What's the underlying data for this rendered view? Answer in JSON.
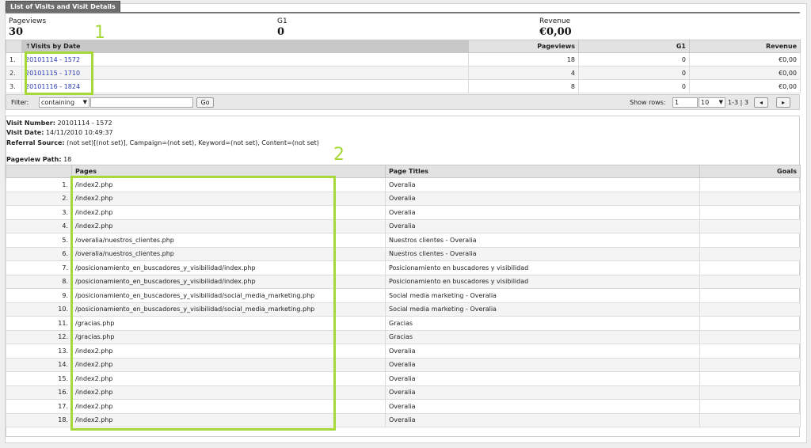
{
  "tab_title": "List of Visits and Visit Details",
  "summary": [
    {
      "label": "Pageviews",
      "value": "30"
    },
    {
      "label": "G1",
      "value": "0"
    },
    {
      "label": "Revenue",
      "value": "€0,00"
    }
  ],
  "visits": {
    "headers": {
      "sort_icon": "↑",
      "visit": "Visits by Date",
      "pageviews": "Pageviews",
      "g1": "G1",
      "revenue": "Revenue"
    },
    "rows": [
      {
        "idx": "1.",
        "visit": "20101114 - 1572",
        "pageviews": "18",
        "g1": "0",
        "revenue": "€0,00"
      },
      {
        "idx": "2.",
        "visit": "20101115 - 1710",
        "pageviews": "4",
        "g1": "0",
        "revenue": "€0,00"
      },
      {
        "idx": "3.",
        "visit": "20101116 - 1824",
        "pageviews": "8",
        "g1": "0",
        "revenue": "€0,00"
      }
    ]
  },
  "filter": {
    "label": "Filter:",
    "mode": "containing",
    "value": "",
    "go": "Go",
    "show_rows_label": "Show rows:",
    "start_row": "1",
    "rows_per_page": "10",
    "range": "1-3 | 3",
    "prev": "◂",
    "next": "▸"
  },
  "detail": {
    "visit_number_label": "Visit Number:",
    "visit_number": "20101114 - 1572",
    "visit_date_label": "Visit Date:",
    "visit_date": "14/11/2010 10:49:37",
    "referral_label": "Referral Source:",
    "referral": "(not set)[(not set)], Campaign=(not set), Keyword=(not set), Content=(not set)",
    "path_label": "Pageview Path:",
    "path_count": "18"
  },
  "pageviews": {
    "headers": {
      "pages": "Pages",
      "titles": "Page Titles",
      "goals": "Goals"
    },
    "rows": [
      {
        "idx": "1.",
        "page": "/index2.php",
        "title": "Overalia"
      },
      {
        "idx": "2.",
        "page": "/index2.php",
        "title": "Overalia"
      },
      {
        "idx": "3.",
        "page": "/index2.php",
        "title": "Overalia"
      },
      {
        "idx": "4.",
        "page": "/index2.php",
        "title": "Overalia"
      },
      {
        "idx": "5.",
        "page": "/overalia/nuestros_clientes.php",
        "title": "Nuestros clientes - Overalia"
      },
      {
        "idx": "6.",
        "page": "/overalia/nuestros_clientes.php",
        "title": "Nuestros clientes - Overalia"
      },
      {
        "idx": "7.",
        "page": "/posicionamiento_en_buscadores_y_visibilidad/index.php",
        "title": "Posicionamiento en buscadores y visibilidad"
      },
      {
        "idx": "8.",
        "page": "/posicionamiento_en_buscadores_y_visibilidad/index.php",
        "title": "Posicionamiento en buscadores y visibilidad"
      },
      {
        "idx": "9.",
        "page": "/posicionamiento_en_buscadores_y_visibilidad/social_media_marketing.php",
        "title": "Social media marketing - Overalia"
      },
      {
        "idx": "10.",
        "page": "/posicionamiento_en_buscadores_y_visibilidad/social_media_marketing.php",
        "title": "Social media marketing - Overalia"
      },
      {
        "idx": "11.",
        "page": "/gracias.php",
        "title": "Gracias"
      },
      {
        "idx": "12.",
        "page": "/gracias.php",
        "title": "Gracias"
      },
      {
        "idx": "13.",
        "page": "/index2.php",
        "title": "Overalia"
      },
      {
        "idx": "14.",
        "page": "/index2.php",
        "title": "Overalia"
      },
      {
        "idx": "15.",
        "page": "/index2.php",
        "title": "Overalia"
      },
      {
        "idx": "16.",
        "page": "/index2.php",
        "title": "Overalia"
      },
      {
        "idx": "17.",
        "page": "/index2.php",
        "title": "Overalia"
      },
      {
        "idx": "18.",
        "page": "/index2.php",
        "title": "Overalia"
      }
    ]
  },
  "annotations": {
    "mark1": "1",
    "mark2": "2",
    "highlight_color": "#a6d83a"
  }
}
